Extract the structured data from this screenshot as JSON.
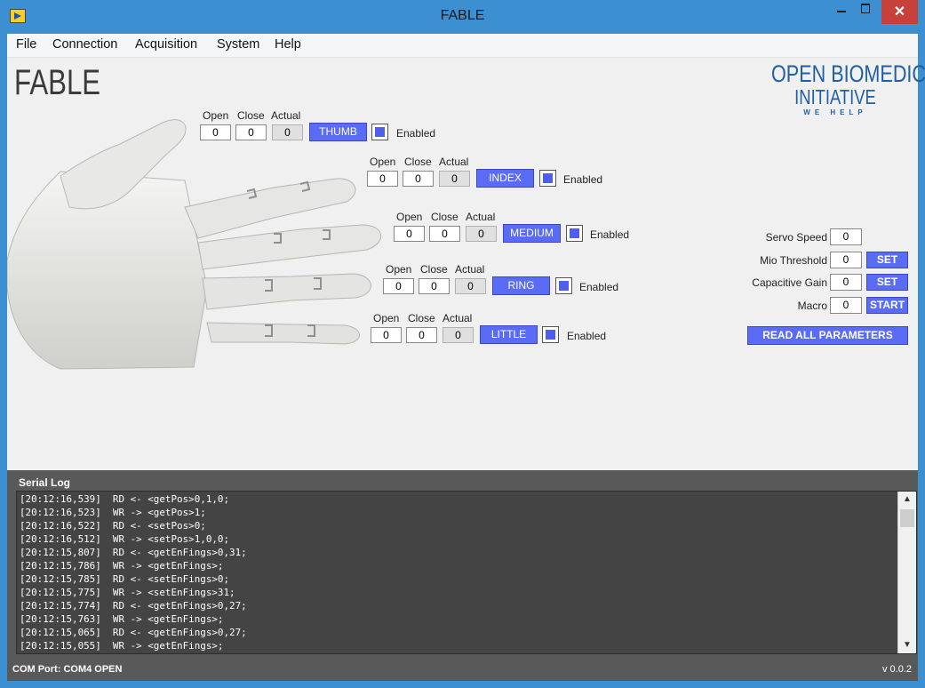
{
  "window": {
    "title": "FABLE",
    "close": "✕"
  },
  "menu": [
    "File",
    "Connection",
    "Acquisition",
    "System",
    "Help"
  ],
  "logos": {
    "fable": "FABLE",
    "obi_line1": "OPEN BIOMEDICAL",
    "obi_line2": "INITIATIVE",
    "obi_tagline": "WE HELP"
  },
  "labels": {
    "open": "Open",
    "close": "Close",
    "actual": "Actual",
    "enabled": "Enabled"
  },
  "fingers": [
    {
      "name": "THUMB",
      "open": "0",
      "close": "0",
      "actual": "0",
      "enabled": true
    },
    {
      "name": "INDEX",
      "open": "0",
      "close": "0",
      "actual": "0",
      "enabled": true
    },
    {
      "name": "MEDIUM",
      "open": "0",
      "close": "0",
      "actual": "0",
      "enabled": true
    },
    {
      "name": "RING",
      "open": "0",
      "close": "0",
      "actual": "0",
      "enabled": true
    },
    {
      "name": "LITTLE",
      "open": "0",
      "close": "0",
      "actual": "0",
      "enabled": true
    }
  ],
  "params": {
    "servo_speed": {
      "label": "Servo Speed",
      "value": "0"
    },
    "mio_threshold": {
      "label": "Mio Threshold",
      "value": "0",
      "button": "SET"
    },
    "capacitive_gain": {
      "label": "Capacitive Gain",
      "value": "0",
      "button": "SET"
    },
    "macro": {
      "label": "Macro",
      "value": "0",
      "button": "START"
    },
    "read_all": "READ ALL PARAMETERS"
  },
  "serial_log": {
    "title": "Serial Log",
    "lines": [
      "[20:12:16,539]  RD <- <getPos>0,1,0;",
      "[20:12:16,523]  WR -> <getPos>1;",
      "[20:12:16,522]  RD <- <setPos>0;",
      "[20:12:16,512]  WR -> <setPos>1,0,0;",
      "[20:12:15,807]  RD <- <getEnFings>0,31;",
      "[20:12:15,786]  WR -> <getEnFings>;",
      "[20:12:15,785]  RD <- <setEnFings>0;",
      "[20:12:15,775]  WR -> <setEnFings>31;",
      "[20:12:15,774]  RD <- <getEnFings>0,27;",
      "[20:12:15,763]  WR -> <getEnFings>;",
      "[20:12:15,065]  RD <- <getEnFings>0,27;",
      "[20:12:15,055]  WR -> <getEnFings>;"
    ]
  },
  "status": {
    "com_port": "COM Port: COM4 OPEN",
    "version": "v 0.0.2"
  },
  "colors": {
    "accent": "#5a6cf5",
    "window_frame": "#3c8fd0",
    "close_button": "#c7413a",
    "log_bg": "#595959"
  }
}
